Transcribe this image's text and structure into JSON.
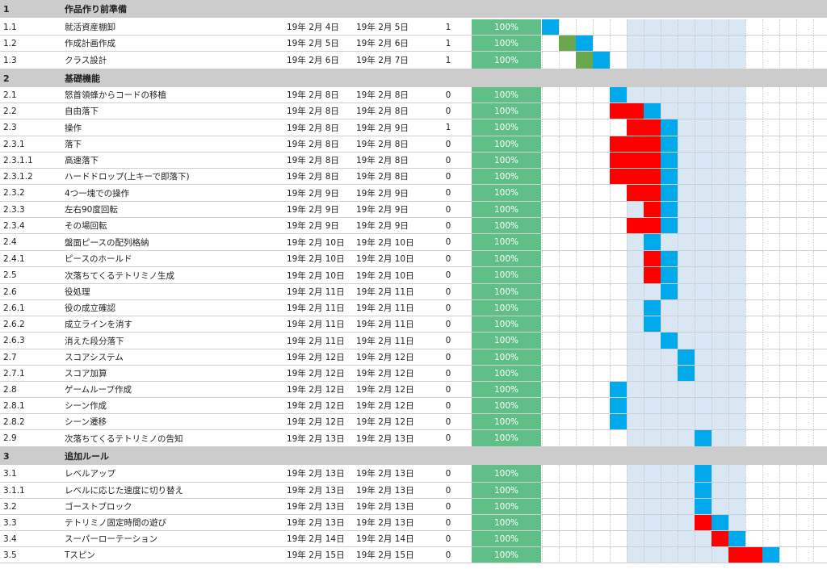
{
  "colors": {
    "section_bg": "#cccccc",
    "progress_bg": "#5fbf87",
    "plan_blue": "#00a9ec",
    "actual_red": "#ff0000",
    "prep_green": "#6aa84f",
    "shade": "#d9e7f5"
  },
  "rows": [
    {
      "type": "section",
      "id": "1",
      "name": "作品作り前準備"
    },
    {
      "type": "task",
      "id": "1.1",
      "name": "就活資産棚卸",
      "start": "19年 2月 4日",
      "end": "19年 2月 5日",
      "duration": "1",
      "progress": "100%"
    },
    {
      "type": "task",
      "id": "1.2",
      "name": "作成計画作成",
      "start": "19年 2月 5日",
      "end": "19年 2月 6日",
      "duration": "1",
      "progress": "100%"
    },
    {
      "type": "task",
      "id": "1.3",
      "name": "クラス設計",
      "start": "19年 2月 6日",
      "end": "19年 2月 7日",
      "duration": "1",
      "progress": "100%"
    },
    {
      "type": "section",
      "id": "2",
      "name": "基礎機能"
    },
    {
      "type": "task",
      "id": "2.1",
      "name": "怒首領蜂からコードの移植",
      "start": "19年 2月 8日",
      "end": "19年 2月 8日",
      "duration": "0",
      "progress": "100%"
    },
    {
      "type": "task",
      "id": "2.2",
      "name": "自由落下",
      "start": "19年 2月 8日",
      "end": "19年 2月 8日",
      "duration": "0",
      "progress": "100%"
    },
    {
      "type": "task",
      "id": "2.3",
      "name": "操作",
      "start": "19年 2月 8日",
      "end": "19年 2月 9日",
      "duration": "1",
      "progress": "100%"
    },
    {
      "type": "task",
      "id": "2.3.1",
      "name": "落下",
      "start": "19年 2月 8日",
      "end": "19年 2月 8日",
      "duration": "0",
      "progress": "100%"
    },
    {
      "type": "task",
      "id": "2.3.1.1",
      "name": "高速落下",
      "start": "19年 2月 8日",
      "end": "19年 2月 8日",
      "duration": "0",
      "progress": "100%"
    },
    {
      "type": "task",
      "id": "2.3.1.2",
      "name": "ハードドロップ(上キーで即落下)",
      "start": "19年 2月 8日",
      "end": "19年 2月 8日",
      "duration": "0",
      "progress": "100%"
    },
    {
      "type": "task",
      "id": "2.3.2",
      "name": "4つ一塊での操作",
      "start": "19年 2月 9日",
      "end": "19年 2月 9日",
      "duration": "0",
      "progress": "100%"
    },
    {
      "type": "task",
      "id": "2.3.3",
      "name": "左右90度回転",
      "start": "19年 2月 9日",
      "end": "19年 2月 9日",
      "duration": "0",
      "progress": "100%"
    },
    {
      "type": "task",
      "id": "2.3.4",
      "name": "その場回転",
      "start": "19年 2月 9日",
      "end": "19年 2月 9日",
      "duration": "0",
      "progress": "100%"
    },
    {
      "type": "task",
      "id": "2.4",
      "name": "盤面ピースの配列格納",
      "start": "19年 2月 10日",
      "end": "19年 2月 10日",
      "duration": "0",
      "progress": "100%"
    },
    {
      "type": "task",
      "id": "2.4.1",
      "name": "ピースのホールド",
      "start": "19年 2月 10日",
      "end": "19年 2月 10日",
      "duration": "0",
      "progress": "100%"
    },
    {
      "type": "task",
      "id": "2.5",
      "name": "次落ちてくるテトリミノ生成",
      "start": "19年 2月 10日",
      "end": "19年 2月 10日",
      "duration": "0",
      "progress": "100%"
    },
    {
      "type": "task",
      "id": "2.6",
      "name": "役処理",
      "start": "19年 2月 11日",
      "end": "19年 2月 11日",
      "duration": "0",
      "progress": "100%"
    },
    {
      "type": "task",
      "id": "2.6.1",
      "name": "役の成立確認",
      "start": "19年 2月 11日",
      "end": "19年 2月 11日",
      "duration": "0",
      "progress": "100%"
    },
    {
      "type": "task",
      "id": "2.6.2",
      "name": "成立ラインを消す",
      "start": "19年 2月 11日",
      "end": "19年 2月 11日",
      "duration": "0",
      "progress": "100%"
    },
    {
      "type": "task",
      "id": "2.6.3",
      "name": "消えた段分落下",
      "start": "19年 2月 11日",
      "end": "19年 2月 11日",
      "duration": "0",
      "progress": "100%"
    },
    {
      "type": "task",
      "id": "2.7",
      "name": "スコアシステム",
      "start": "19年 2月 12日",
      "end": "19年 2月 12日",
      "duration": "0",
      "progress": "100%"
    },
    {
      "type": "task",
      "id": "2.7.1",
      "name": "スコア加算",
      "start": "19年 2月 12日",
      "end": "19年 2月 12日",
      "duration": "0",
      "progress": "100%"
    },
    {
      "type": "task",
      "id": "2.8",
      "name": "ゲームループ作成",
      "start": "19年 2月 12日",
      "end": "19年 2月 12日",
      "duration": "0",
      "progress": "100%"
    },
    {
      "type": "task",
      "id": "2.8.1",
      "name": "シーン作成",
      "start": "19年 2月 12日",
      "end": "19年 2月 12日",
      "duration": "0",
      "progress": "100%"
    },
    {
      "type": "task",
      "id": "2.8.2",
      "name": "シーン遷移",
      "start": "19年 2月 12日",
      "end": "19年 2月 12日",
      "duration": "0",
      "progress": "100%"
    },
    {
      "type": "task",
      "id": "2.9",
      "name": "次落ちてくるテトリミノの告知",
      "start": "19年 2月 13日",
      "end": "19年 2月 13日",
      "duration": "0",
      "progress": "100%"
    },
    {
      "type": "section",
      "id": "3",
      "name": "追加ルール"
    },
    {
      "type": "task",
      "id": "3.1",
      "name": "レベルアップ",
      "start": "19年 2月 13日",
      "end": "19年 2月 13日",
      "duration": "0",
      "progress": "100%"
    },
    {
      "type": "task",
      "id": "3.1.1",
      "name": "レベルに応じた速度に切り替え",
      "start": "19年 2月 13日",
      "end": "19年 2月 13日",
      "duration": "0",
      "progress": "100%"
    },
    {
      "type": "task",
      "id": "3.2",
      "name": "ゴーストブロック",
      "start": "19年 2月 13日",
      "end": "19年 2月 13日",
      "duration": "0",
      "progress": "100%"
    },
    {
      "type": "task",
      "id": "3.3",
      "name": "テトリミノ固定時間の遊び",
      "start": "19年 2月 13日",
      "end": "19年 2月 13日",
      "duration": "0",
      "progress": "100%"
    },
    {
      "type": "task",
      "id": "3.4",
      "name": "スーパーローテーション",
      "start": "19年 2月 14日",
      "end": "19年 2月 14日",
      "duration": "0",
      "progress": "100%"
    },
    {
      "type": "task",
      "id": "3.5",
      "name": "Tスピン",
      "start": "19年 2月 15日",
      "end": "19年 2月 15日",
      "duration": "0",
      "progress": "100%"
    }
  ]
}
